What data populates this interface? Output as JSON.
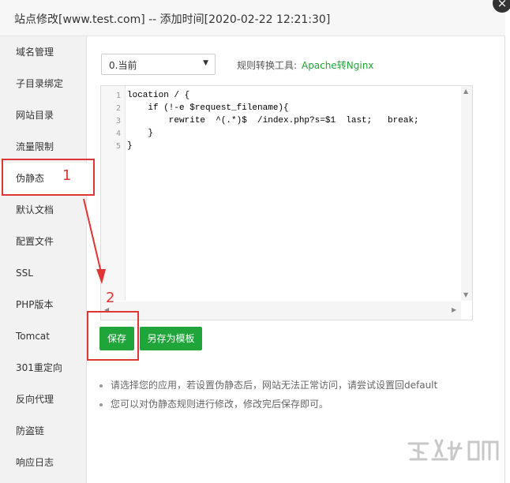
{
  "dialog": {
    "title": "站点修改[www.test.com] -- 添加时间[2020-02-22 12:21:30]",
    "close_glyph": "×"
  },
  "sidebar": {
    "items": [
      {
        "label": "域名管理"
      },
      {
        "label": "子目录绑定"
      },
      {
        "label": "网站目录"
      },
      {
        "label": "流量限制"
      },
      {
        "label": "伪静态",
        "active": true
      },
      {
        "label": "默认文档"
      },
      {
        "label": "配置文件"
      },
      {
        "label": "SSL"
      },
      {
        "label": "PHP版本"
      },
      {
        "label": "Tomcat"
      },
      {
        "label": "301重定向"
      },
      {
        "label": "反向代理"
      },
      {
        "label": "防盗链"
      },
      {
        "label": "响应日志"
      }
    ]
  },
  "rewrite": {
    "version_selected": "0.当前",
    "convert_label": "规则转换工具:",
    "convert_link": "Apache转Nginx",
    "code_lines": [
      {
        "num": "1",
        "text": "location / {"
      },
      {
        "num": "2",
        "text": "    if (!-e $request_filename){"
      },
      {
        "num": "3",
        "text": "        rewrite  ^(.*)$  /index.php?s=$1  last;   break;"
      },
      {
        "num": "4",
        "text": "    }"
      },
      {
        "num": "5",
        "text": "}"
      }
    ],
    "save_label": "保存",
    "save_template_label": "另存为模板",
    "tips": [
      "请选择您的应用，若设置伪静态后，网站无法正常访问，请尝试设置回default",
      "您可以对伪静态规则进行修改，修改完后保存即可。"
    ]
  },
  "annotations": {
    "step1": "1",
    "step2": "2",
    "color": "#e03535"
  },
  "colors": {
    "accent": "#20a53a",
    "sidebar_bg": "#f2f2f2",
    "title_bg": "#f7f7f7"
  }
}
